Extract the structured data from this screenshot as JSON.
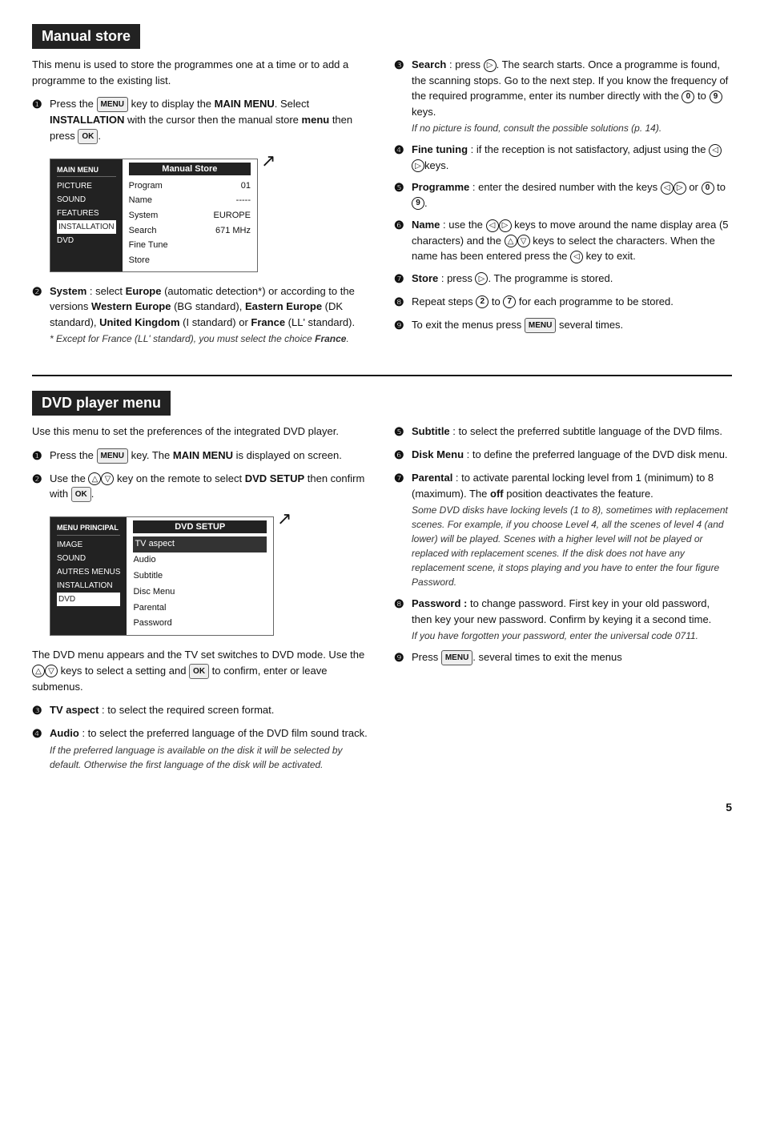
{
  "page": {
    "number": "5"
  },
  "manual_store": {
    "title": "Manual store",
    "intro": "This menu is used to store the programmes one at a time or to add a programme to the existing list.",
    "steps_left": [
      {
        "num": "1",
        "text": "Press the",
        "key": "MENU",
        "text2": "key to display the",
        "bold": "MAIN MENU",
        "text3": ". Select",
        "bold2": "INSTALLATION",
        "text4": "with the cursor then the manual store",
        "bold3": "menu",
        "text5": "then press",
        "ok": "OK"
      },
      {
        "num": "2",
        "bold": "System",
        "text": ": select",
        "bold2": "Europe",
        "text2": "(automatic detection*) or according to the versions",
        "bold3": "Western Europe",
        "text3": "(BG standard),",
        "bold4": "Eastern Europe",
        "text4": "(DK standard),",
        "bold5": "United Kingdom",
        "text5": "(I standard) or",
        "bold6": "France",
        "text6": "(LL' standard).",
        "italic": "* Except for France (LL' standard), you must select the choice",
        "italic_bold": "France"
      }
    ],
    "menu_box": {
      "left_title": "MAIN MENU",
      "left_items": [
        "PICTURE",
        "SOUND",
        "FEATURES",
        "INSTALLATION",
        "DVD"
      ],
      "left_selected": "INSTALLATION",
      "right_title": "Manual Store",
      "right_rows": [
        {
          "label": "Program",
          "value": "01"
        },
        {
          "label": "Name",
          "value": "-----"
        },
        {
          "label": "System",
          "value": "EUROPE"
        },
        {
          "label": "Search",
          "value": "671 MHz"
        },
        {
          "label": "Fine Tune",
          "value": ""
        },
        {
          "label": "Store",
          "value": ""
        }
      ]
    },
    "steps_right": [
      {
        "num": "3",
        "bold": "Search",
        "text": ": press",
        "circle": "▷",
        "text2": ". The search starts. Once a programme is found, the scanning stops. Go to the next step. If you know the frequency of the required programme, enter its number directly with the",
        "circle0": "0",
        "text3": "to",
        "circle9": "9",
        "text4": "keys.",
        "italic": "If no picture is found, consult the possible solutions (p. 14)."
      },
      {
        "num": "4",
        "bold": "Fine tuning",
        "text": ": if the reception is not satisfactory, adjust using the",
        "arrows": "◁▷",
        "text2": "keys."
      },
      {
        "num": "5",
        "bold": "Programme",
        "text": ": enter the desired number with the keys",
        "arrows2": "◁▷",
        "text2": "or",
        "circle0": "0",
        "text3": "to",
        "circle9": "9"
      },
      {
        "num": "6",
        "bold": "Name",
        "text": ": use the",
        "arrows3": "◁▷",
        "text2": "keys to move around the name display area (5 characters) and the",
        "arrows4": "△▽",
        "text3": "keys to select the characters. When the name has been entered press the",
        "arrowLeft": "◁",
        "text4": "key to exit."
      },
      {
        "num": "7",
        "bold": "Store",
        "text": ": press",
        "circle": "▷",
        "text2": ". The programme is stored."
      },
      {
        "num": "8",
        "text": "Repeat steps",
        "ref2": "2",
        "text2": "to",
        "ref7": "7",
        "text3": "for each programme to be stored."
      },
      {
        "num": "9",
        "text": "To exit the menus press",
        "key": "MENU",
        "text2": "several times."
      }
    ]
  },
  "dvd_player_menu": {
    "title": "DVD player menu",
    "intro": "Use this menu to set the preferences of the integrated DVD player.",
    "steps_left": [
      {
        "num": "1",
        "text": "Press the",
        "key": "MENU",
        "text2": "key. The",
        "bold": "MAIN MENU",
        "text3": "is displayed on screen."
      },
      {
        "num": "2",
        "text": "Use the",
        "arrows": "△▽",
        "text2": "key on the remote to select",
        "bold": "DVD SETUP",
        "text3": "then confirm with",
        "ok": "OK"
      }
    ],
    "menu_box": {
      "left_title": "MENU PRINCIPAL",
      "left_items": [
        "IMAGE",
        "SOUND",
        "AUTRES MENUS",
        "INSTALLATION",
        "DVD"
      ],
      "left_selected": "DVD",
      "right_title": "DVD SETUP",
      "right_items": [
        "TV aspect",
        "Audio",
        "Subtitle",
        "Disc Menu",
        "Parental",
        "Password"
      ],
      "right_selected": "TV aspect"
    },
    "bottom_text": "The DVD menu appears and the TV set switches to DVD mode. Use the",
    "bottom_arrows": "△▽",
    "bottom_text2": "keys to select a setting and",
    "bottom_ok": "OK",
    "bottom_text3": "to confirm, enter or leave submenus.",
    "steps_left2": [
      {
        "num": "3",
        "bold": "TV aspect",
        "text": ": to select the required screen format."
      },
      {
        "num": "4",
        "bold": "Audio",
        "text": ": to select the preferred language of the DVD film sound track.",
        "italic": "If the preferred language is available on the disk it will be selected by default. Otherwise the first language of the disk will be activated."
      }
    ],
    "steps_right": [
      {
        "num": "5",
        "bold": "Subtitle",
        "text": ": to select the preferred subtitle language of the DVD films."
      },
      {
        "num": "6",
        "bold": "Disk Menu",
        "text": ": to define the preferred language of the DVD disk menu."
      },
      {
        "num": "7",
        "bold": "Parental",
        "text": ": to activate parental locking level from 1 (minimum) to 8 (maximum). The",
        "bold2": "off",
        "text2": "position deactivates the feature.",
        "italic": "Some DVD disks have locking levels (1 to 8), sometimes with replacement scenes. For example, if you choose Level 4, all the scenes of level 4 (and lower) will be played. Scenes with a higher level will not be played or replaced with replacement scenes. If the disk does not have any replacement scene, it stops playing and you have to enter the four figure Password."
      },
      {
        "num": "8",
        "bold": "Password",
        "text": ": to change password. First key in your old password, then key your new password. Confirm by keying it a second time.",
        "italic": "If you have forgotten your password, enter the universal code 0711."
      },
      {
        "num": "9",
        "text": "Press",
        "key": "MENU",
        "text2": ". several times to exit the menus"
      }
    ]
  }
}
